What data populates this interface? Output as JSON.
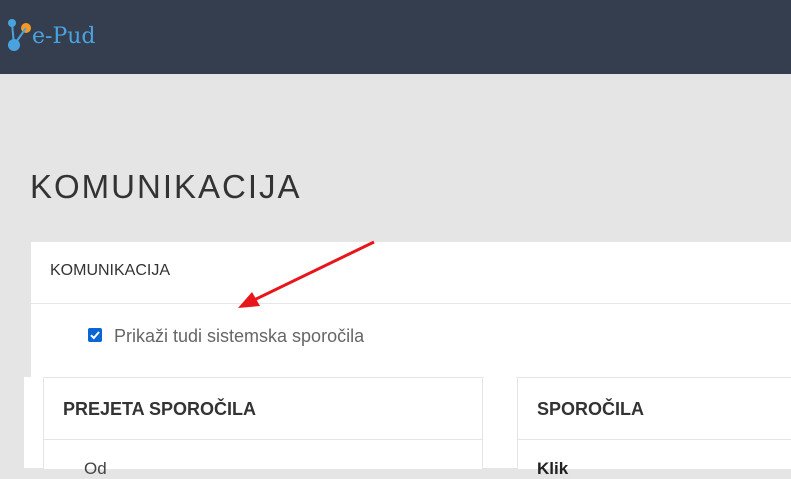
{
  "header": {
    "logo_text": "e-Pud",
    "colors": {
      "bar": "#343e4f",
      "logo_blue": "#4aa3df",
      "logo_orange": "#f59a23"
    }
  },
  "page": {
    "title": "KOMUNIKACIJA"
  },
  "panel": {
    "title": "KOMUNIKACIJA",
    "checkbox_label": "Prikaži tudi sistemska sporočila",
    "checkbox_checked": true,
    "accent": "#0a67d1"
  },
  "received": {
    "title": "PREJETA SPOROČILA",
    "partial_text": "Od"
  },
  "messages": {
    "title": "SPOROČILA",
    "partial_text": "Klik"
  },
  "annotation": {
    "arrow_color": "#e8161b"
  }
}
